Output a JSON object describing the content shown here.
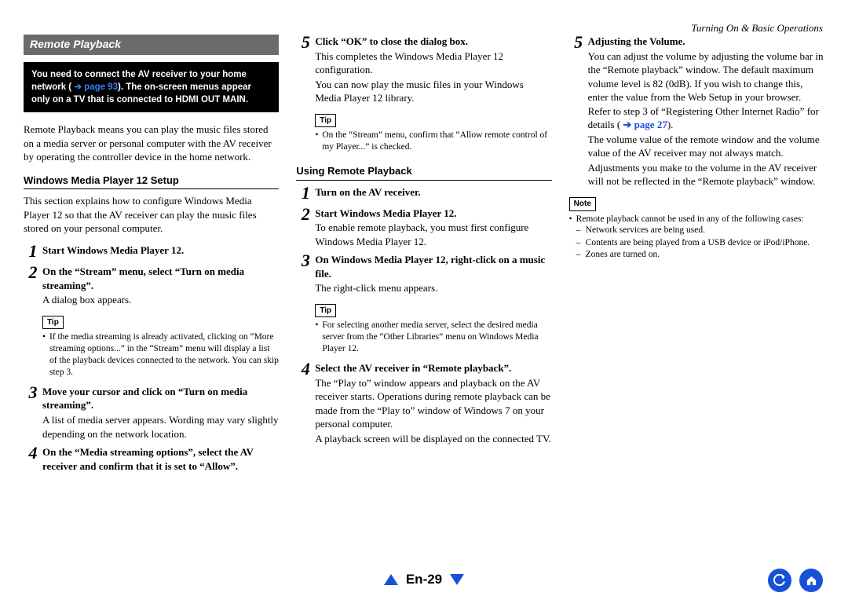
{
  "header": {
    "running": "Turning On & Basic Operations"
  },
  "labels": {
    "tip": "Tip",
    "note": "Note"
  },
  "col1": {
    "sectionTitle": "Remote Playback",
    "warning": {
      "part1": "You need to connect the AV receiver to your home network (",
      "link": "page 93",
      "part2": "). The on-screen menus appear only on a TV that is connected to ",
      "bold": "HDMI OUT MAIN"
    },
    "intro": "Remote Playback means you can play the music files stored on a media server or personal computer with the AV receiver by operating the controller device in the home network.",
    "sub1": {
      "title": "Windows Media Player 12 Setup",
      "desc": "This section explains how to configure Windows Media Player 12 so that the AV receiver can play the music files stored on your personal computer."
    },
    "steps": [
      {
        "num": "1",
        "title": "Start Windows Media Player 12."
      },
      {
        "num": "2",
        "title": "On the “Stream” menu, select “Turn on media streaming”.",
        "desc": "A dialog box appears.",
        "tip": "If the media streaming is already activated, clicking on “More streaming options...” in the “Stream” menu will display a list of the playback devices connected to the network. You can skip step 3."
      },
      {
        "num": "3",
        "title": "Move your cursor and click on “Turn on media streaming”.",
        "desc": "A list of media server appears. Wording may vary slightly depending on the network location."
      },
      {
        "num": "4",
        "title": "On the “Media streaming options”, select the AV receiver and confirm that it is set to “Allow”."
      }
    ]
  },
  "col2": {
    "step5": {
      "num": "5",
      "title": "Click “OK” to close the dialog box.",
      "desc1": "This completes the Windows Media Player 12 configuration.",
      "desc2": "You can now play the music files in your Windows Media Player 12 library.",
      "tip": "On the “Stream” menu, confirm that “Allow remote control of my Player...” is checked."
    },
    "sub2": {
      "title": "Using Remote Playback"
    },
    "steps": [
      {
        "num": "1",
        "title": "Turn on the AV receiver."
      },
      {
        "num": "2",
        "title": "Start Windows Media Player 12.",
        "desc": "To enable remote playback, you must first configure Windows Media Player 12."
      },
      {
        "num": "3",
        "title": "On Windows Media Player 12, right-click on a music file.",
        "desc": "The right-click menu appears.",
        "tip": "For selecting another media server, select the desired media server from the “Other Libraries” menu on Windows Media Player 12."
      },
      {
        "num": "4",
        "title": "Select the AV receiver in “Remote playback”.",
        "desc1": "The “Play to” window appears and playback on the AV receiver starts. Operations during remote playback can be made from the “Play to” window of Windows 7 on your personal computer.",
        "desc2": "A playback screen will be displayed on the connected TV."
      }
    ]
  },
  "col3": {
    "step5": {
      "num": "5",
      "title": "Adjusting the Volume.",
      "desc1a": "You can adjust the volume by adjusting the volume bar in the “Remote playback” window. The default maximum volume level is 82 (0dB). If you wish to change this, enter the value from the Web Setup in your browser. Refer to step 3 of “Registering Other Internet Radio” for details (",
      "link": "page 27",
      "desc1b": ").",
      "desc2": "The volume value of the remote window and the volume value of the AV receiver may not always match.",
      "desc3": "Adjustments you make to the volume in the AV receiver will not be reflected in the “Remote playback” window."
    },
    "note": {
      "lead": "Remote playback cannot be used in any of the following cases:",
      "items": [
        "Network services are being used.",
        "Contents are being played from a USB device or iPod/iPhone.",
        "Zones are turned on."
      ]
    }
  },
  "footer": {
    "page": "En-29"
  }
}
